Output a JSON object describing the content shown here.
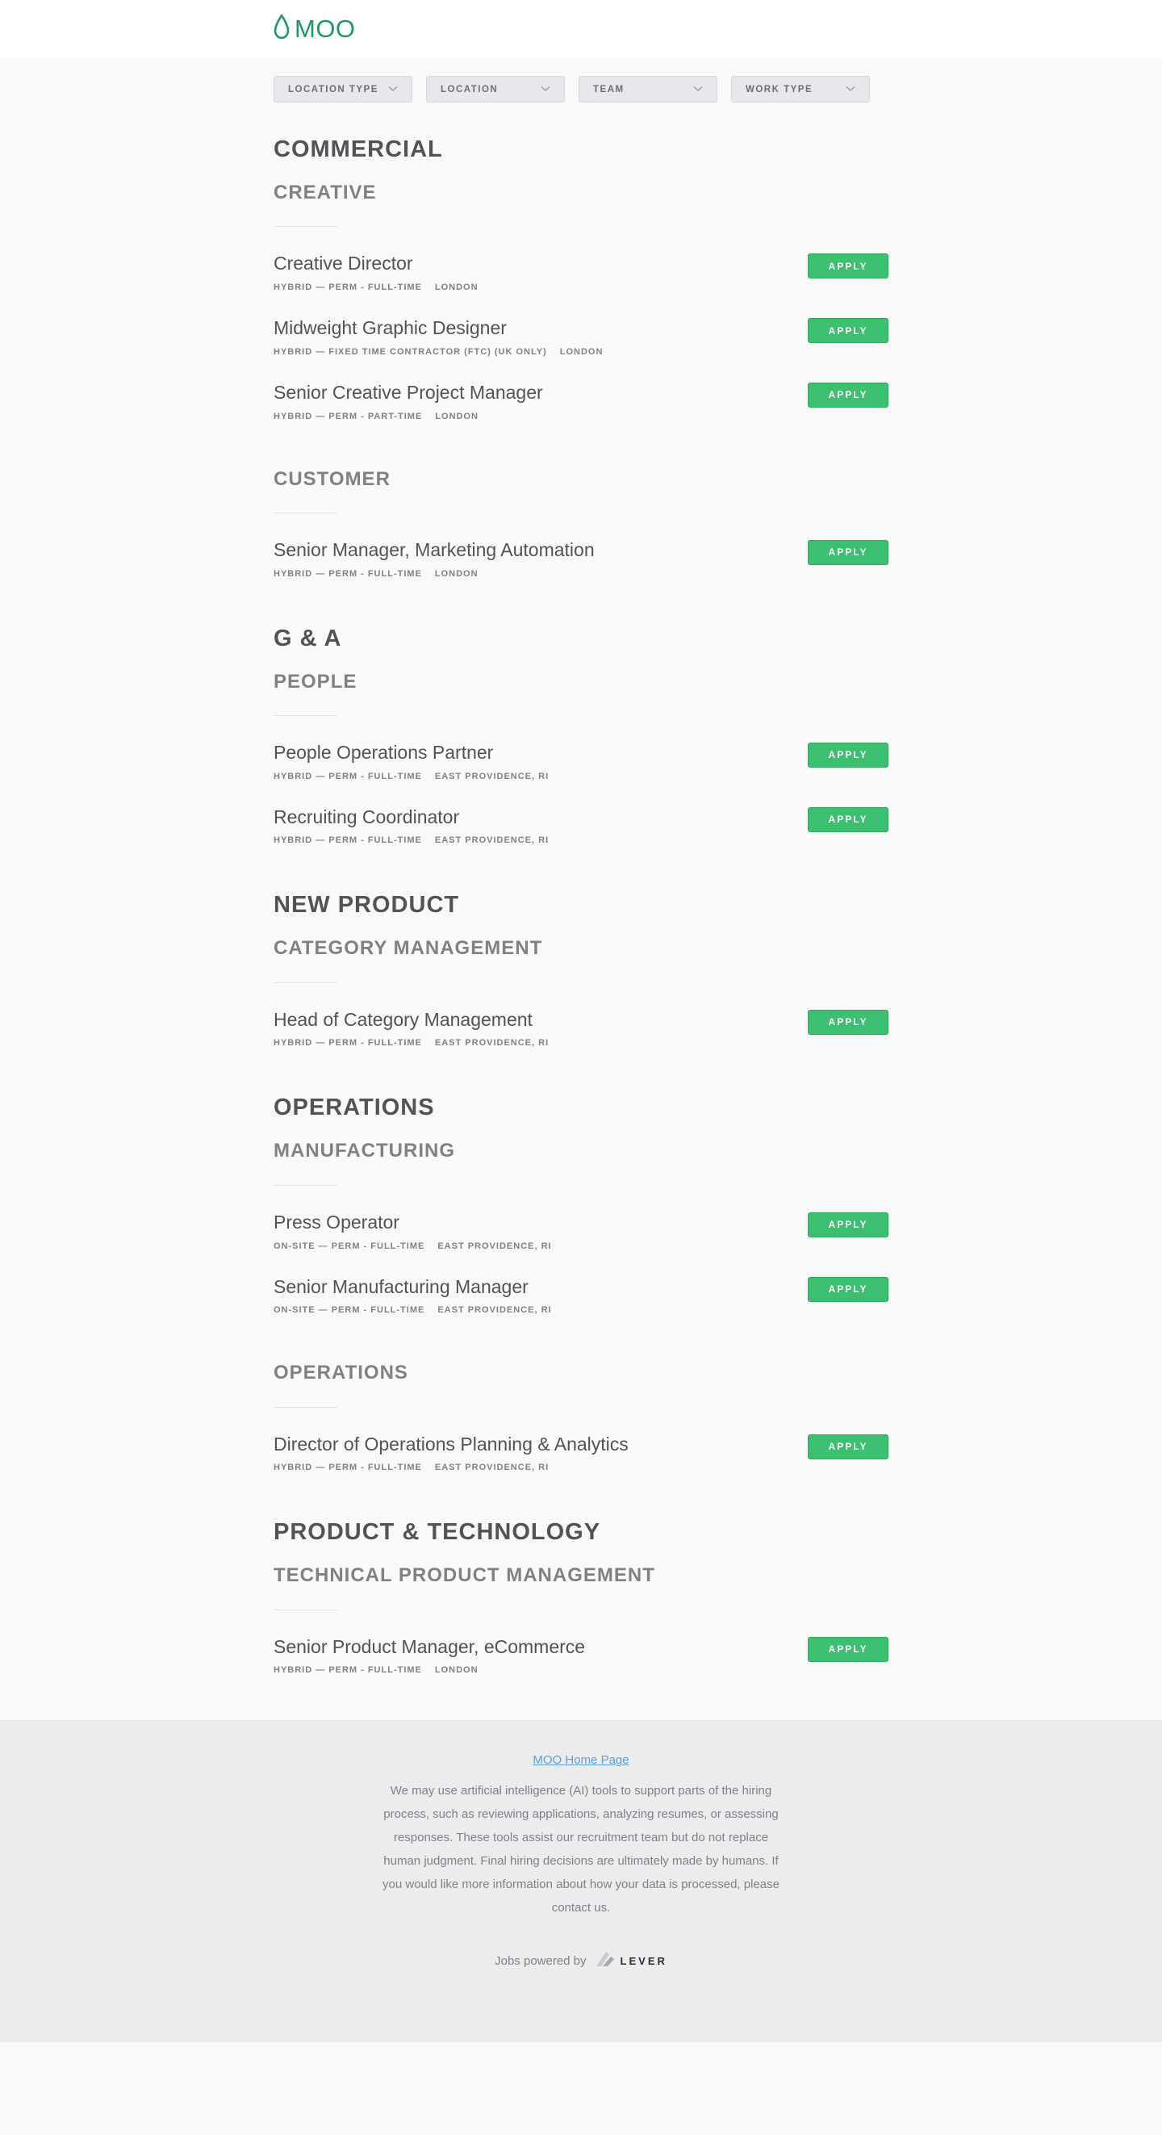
{
  "brand": {
    "name": "MOO",
    "color": "#1d9a5f"
  },
  "filters": [
    {
      "label": "LOCATION TYPE"
    },
    {
      "label": "LOCATION"
    },
    {
      "label": "TEAM"
    },
    {
      "label": "WORK TYPE"
    }
  ],
  "apply_label": "APPLY",
  "categories": [
    {
      "title": "COMMERCIAL",
      "teams": [
        {
          "title": "CREATIVE",
          "postings": [
            {
              "title": "Creative Director",
              "commitment": "HYBRID — PERM - FULL-TIME",
              "location": "LONDON"
            },
            {
              "title": "Midweight Graphic Designer",
              "commitment": "HYBRID — FIXED TIME CONTRACTOR (FTC) (UK ONLY)",
              "location": "LONDON"
            },
            {
              "title": "Senior Creative Project Manager",
              "commitment": "HYBRID — PERM - PART-TIME",
              "location": "LONDON"
            }
          ]
        },
        {
          "title": "CUSTOMER",
          "postings": [
            {
              "title": "Senior Manager, Marketing Automation",
              "commitment": "HYBRID — PERM - FULL-TIME",
              "location": "LONDON"
            }
          ]
        }
      ]
    },
    {
      "title": "G & A",
      "teams": [
        {
          "title": "PEOPLE",
          "postings": [
            {
              "title": "People Operations Partner",
              "commitment": "HYBRID — PERM - FULL-TIME",
              "location": "EAST PROVIDENCE, RI"
            },
            {
              "title": "Recruiting Coordinator",
              "commitment": "HYBRID — PERM - FULL-TIME",
              "location": "EAST PROVIDENCE, RI"
            }
          ]
        }
      ]
    },
    {
      "title": "NEW PRODUCT",
      "teams": [
        {
          "title": "CATEGORY MANAGEMENT",
          "postings": [
            {
              "title": "Head of Category Management",
              "commitment": "HYBRID — PERM - FULL-TIME",
              "location": "EAST PROVIDENCE, RI"
            }
          ]
        }
      ]
    },
    {
      "title": "OPERATIONS",
      "teams": [
        {
          "title": "MANUFACTURING",
          "postings": [
            {
              "title": "Press Operator",
              "commitment": "ON-SITE — PERM - FULL-TIME",
              "location": "EAST PROVIDENCE, RI"
            },
            {
              "title": "Senior Manufacturing Manager",
              "commitment": "ON-SITE — PERM - FULL-TIME",
              "location": "EAST PROVIDENCE, RI"
            }
          ]
        },
        {
          "title": "OPERATIONS",
          "postings": [
            {
              "title": "Director of Operations Planning & Analytics",
              "commitment": "HYBRID — PERM - FULL-TIME",
              "location": "EAST PROVIDENCE, RI"
            }
          ]
        }
      ]
    },
    {
      "title": "PRODUCT & TECHNOLOGY",
      "teams": [
        {
          "title": "TECHNICAL PRODUCT MANAGEMENT",
          "postings": [
            {
              "title": "Senior Product Manager, eCommerce",
              "commitment": "HYBRID — PERM - FULL-TIME",
              "location": "LONDON"
            }
          ]
        }
      ]
    }
  ],
  "footer": {
    "home_link": "MOO Home Page",
    "notice": "We may use artificial intelligence (AI) tools to support parts of the hiring process, such as reviewing applications, analyzing resumes, or assessing responses. These tools assist our recruitment team but do not replace human judgment. Final hiring decisions are ultimately made by humans. If you would like more information about how your data is processed, please contact us.",
    "powered_by": "Jobs powered by",
    "lever_name": "LEVER"
  }
}
